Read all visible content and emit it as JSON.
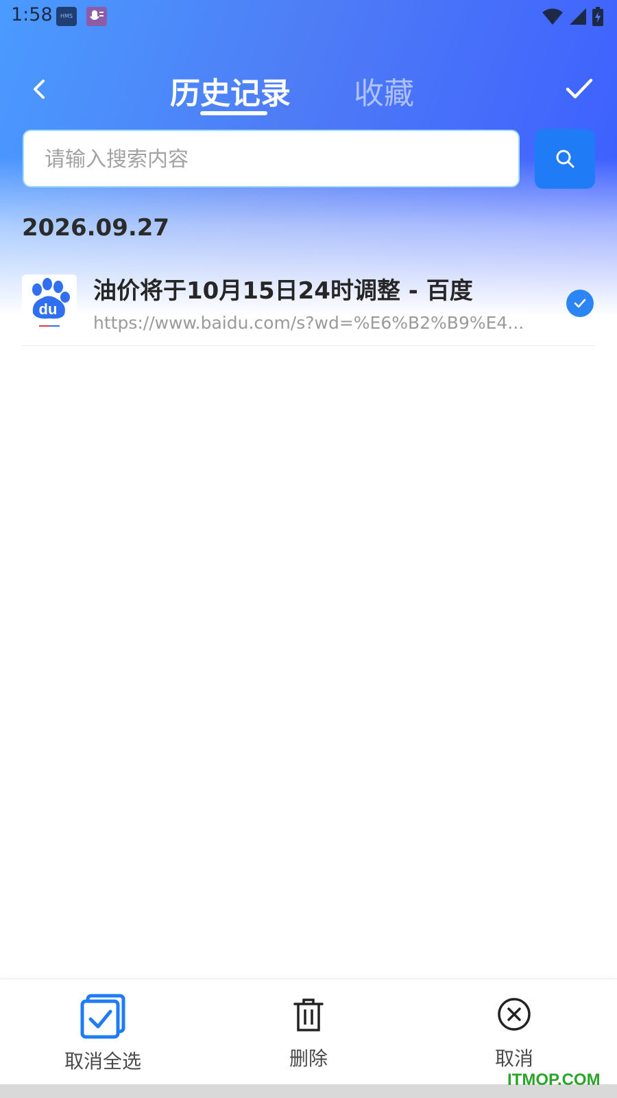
{
  "status_bar": {
    "time": "1:58",
    "hms_icon": "hms-icon",
    "hms_text": "HMS",
    "voice_icon": "voice-assistant-icon",
    "indicators": [
      "wifi-icon",
      "signal-icon",
      "battery-charging-icon"
    ]
  },
  "nav": {
    "back_icon": "chevron-left-icon",
    "tabs": [
      {
        "label": "历史记录",
        "active": true
      },
      {
        "label": "收藏",
        "active": false
      }
    ],
    "confirm_icon": "checkmark-icon"
  },
  "search": {
    "placeholder": "请输入搜索内容",
    "value": "",
    "button_icon": "search-icon"
  },
  "history": {
    "groups": [
      {
        "date": "2026.09.27",
        "items": [
          {
            "favicon": "baidu-logo",
            "favicon_text": "du",
            "title": "油价将于10月15日24时调整 - 百度",
            "url": "https://www.baidu.com/s?wd=%E6%B2%B9%E4...",
            "selected": true
          }
        ]
      }
    ]
  },
  "bottom_bar": {
    "deselect_all": {
      "label": "取消全选",
      "icon": "select-all-checkbox-icon"
    },
    "delete": {
      "label": "删除",
      "icon": "trash-icon"
    },
    "cancel": {
      "label": "取消",
      "icon": "close-circle-icon"
    }
  },
  "watermark": "ITMOP.COM",
  "colors": {
    "accent": "#1f7cf6",
    "header_gradient_start": "#4a9bff",
    "header_gradient_end": "#3b5cff",
    "check": "#2b85f5"
  }
}
